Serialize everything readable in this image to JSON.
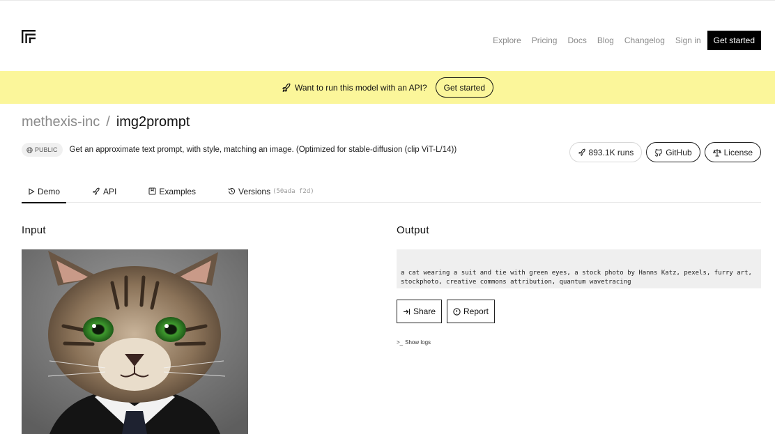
{
  "header": {
    "nav": [
      "Explore",
      "Pricing",
      "Docs",
      "Blog",
      "Changelog",
      "Sign in"
    ],
    "cta": "Get started"
  },
  "banner": {
    "message": "Want to run this model with an API?",
    "button": "Get started",
    "color": "#fbf69a"
  },
  "model": {
    "owner": "methexis-inc",
    "separator": "/",
    "name": "img2prompt",
    "visibility": "PUBLIC",
    "description": "Get an approximate text prompt, with style, matching an image. (Optimized for stable-diffusion (clip ViT-L/14))"
  },
  "stats": {
    "runs": "893.1K runs",
    "github": "GitHub",
    "license": "License"
  },
  "tabs": {
    "demo": "Demo",
    "api": "API",
    "examples": "Examples",
    "versions": "Versions",
    "version_hash": "(50ada f2d)"
  },
  "input": {
    "title": "Input",
    "image_subject": "cat wearing a suit and tie"
  },
  "output": {
    "title": "Output",
    "text": "a cat wearing a suit and tie with green eyes, a stock photo by Hanns Katz, pexels, furry art, stockphoto, creative commons attribution, quantum wavetracing",
    "share": "Share",
    "report": "Report",
    "logs": "Show logs"
  }
}
